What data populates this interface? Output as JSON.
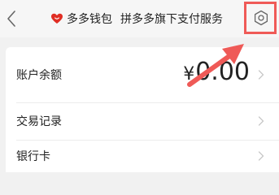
{
  "header": {
    "brand_name": "多多钱包",
    "subtitle": "拼多多旗下支付服务"
  },
  "account": {
    "balance_label": "账户余额",
    "currency": "¥",
    "balance_value": "0.00"
  },
  "menu": {
    "transactions_label": "交易记录",
    "bank_card_label": "银行卡"
  },
  "colors": {
    "brand_red": "#e02e24",
    "annotation": "#ef5a57"
  },
  "icons": {
    "back": "back-arrow-icon",
    "heart": "heart-icon",
    "settings": "gear-icon",
    "chevron": "chevron-right-icon"
  }
}
